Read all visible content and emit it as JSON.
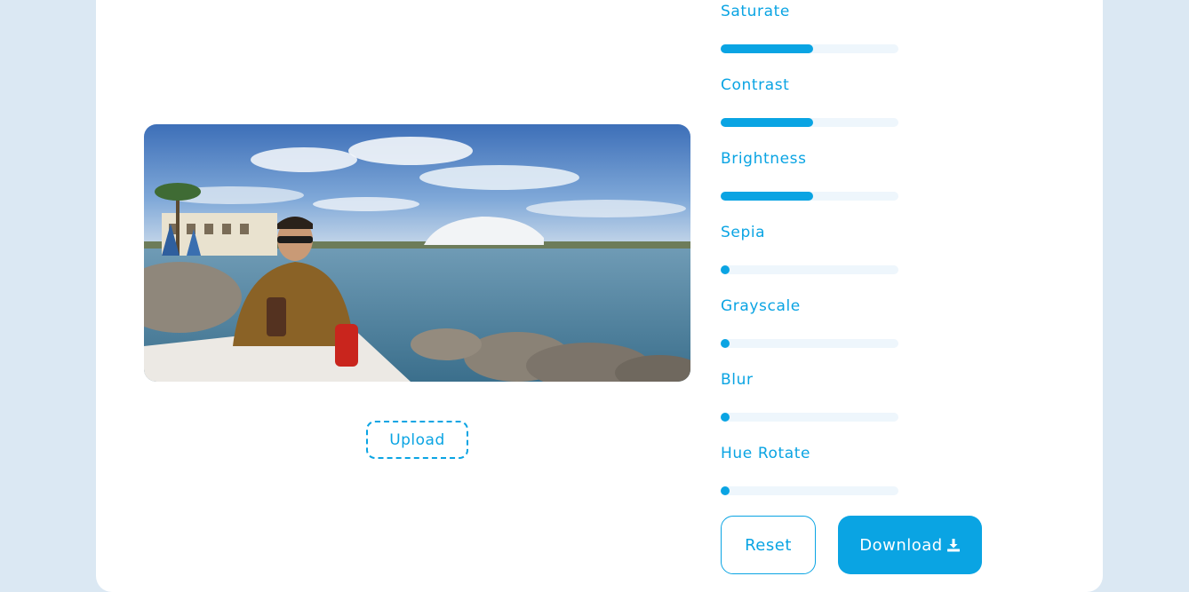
{
  "editor": {
    "upload_label": "Upload",
    "photo_description_icon": "photo-preview"
  },
  "filters": [
    {
      "label": "Saturate",
      "value": 0.52
    },
    {
      "label": "Contrast",
      "value": 0.52
    },
    {
      "label": "Brightness",
      "value": 0.52
    },
    {
      "label": "Sepia",
      "value": 0.0
    },
    {
      "label": "Grayscale",
      "value": 0.0
    },
    {
      "label": "Blur",
      "value": 0.0
    },
    {
      "label": "Hue Rotate",
      "value": 0.0
    }
  ],
  "actions": {
    "reset_label": "Reset",
    "download_label": "Download",
    "download_icon": "download-icon"
  },
  "colors": {
    "accent": "#0aa4e3",
    "background": "#dbe8f3",
    "track": "#eef6fc"
  }
}
